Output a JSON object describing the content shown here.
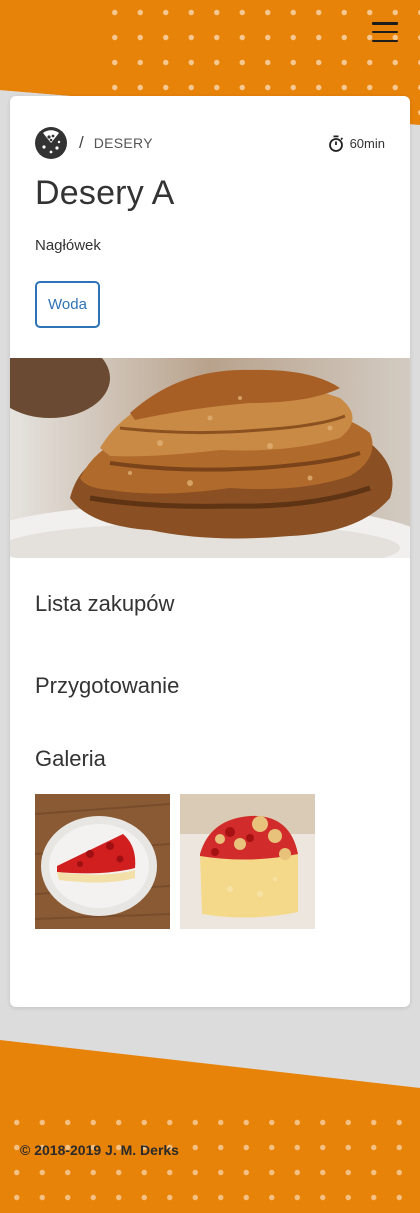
{
  "header": {
    "menu_icon": "hamburger-menu-icon"
  },
  "recipe": {
    "logo_icon": "pizza-icon",
    "breadcrumb_separator": "/",
    "category": "DESERY",
    "time_icon": "stopwatch-icon",
    "time": "60min",
    "title": "Desery A",
    "subtitle": "Nagłówek",
    "tag": "Woda",
    "hero_image": "fried-cutlets-photo"
  },
  "sections": {
    "shopping": "Lista zakupów",
    "preparation": "Przygotowanie",
    "gallery": "Galeria"
  },
  "gallery": [
    {
      "image": "strawberry-cake-slice-photo"
    },
    {
      "image": "strawberry-crumble-cake-photo"
    }
  ],
  "footer": {
    "copyright": "© 2018-2019 J. M. Derks"
  },
  "colors": {
    "brand_orange": "#e8830a",
    "link_blue": "#2d73b5",
    "text": "#333333"
  }
}
